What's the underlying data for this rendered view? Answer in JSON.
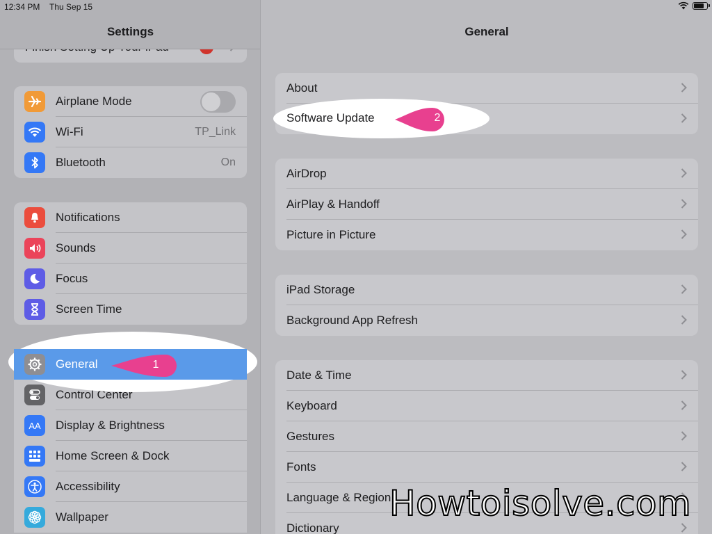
{
  "status_bar": {
    "time": "12:34 PM",
    "date": "Thu Sep 15"
  },
  "sidebar": {
    "title": "Settings",
    "partial_row": "Finish Setting Up Your iPad",
    "groups": [
      {
        "items": [
          {
            "label": "Airplane Mode",
            "icon": "airplane-icon",
            "color": "#f19a37",
            "toggle": false
          },
          {
            "label": "Wi-Fi",
            "icon": "wifi-icon",
            "color": "#3478f6",
            "value": "TP_Link"
          },
          {
            "label": "Bluetooth",
            "icon": "bluetooth-icon",
            "color": "#3478f6",
            "value": "On"
          }
        ]
      },
      {
        "items": [
          {
            "label": "Notifications",
            "icon": "bell-icon",
            "color": "#eb4d3d"
          },
          {
            "label": "Sounds",
            "icon": "speaker-icon",
            "color": "#eb445a"
          },
          {
            "label": "Focus",
            "icon": "moon-icon",
            "color": "#5e5ce6"
          },
          {
            "label": "Screen Time",
            "icon": "hourglass-icon",
            "color": "#5e5ce6"
          }
        ]
      },
      {
        "items": [
          {
            "label": "General",
            "icon": "gear-icon",
            "color": "#8e8e93",
            "selected": true
          },
          {
            "label": "Control Center",
            "icon": "toggles-icon",
            "color": "#8e8e93"
          },
          {
            "label": "Display & Brightness",
            "icon": "text-size-icon",
            "color": "#3478f6",
            "icon_text": "AA"
          },
          {
            "label": "Home Screen & Dock",
            "icon": "grid-icon",
            "color": "#3478f6"
          },
          {
            "label": "Accessibility",
            "icon": "accessibility-icon",
            "color": "#3478f6"
          },
          {
            "label": "Wallpaper",
            "icon": "flower-icon",
            "color": "#35aadc"
          }
        ]
      }
    ]
  },
  "detail": {
    "title": "General",
    "groups": [
      {
        "items": [
          "About",
          "Software Update"
        ]
      },
      {
        "items": [
          "AirDrop",
          "AirPlay & Handoff",
          "Picture in Picture"
        ]
      },
      {
        "items": [
          "iPad Storage",
          "Background App Refresh"
        ]
      },
      {
        "items": [
          "Date & Time",
          "Keyboard",
          "Gestures",
          "Fonts",
          "Language & Region",
          "Dictionary"
        ]
      }
    ]
  },
  "annotations": {
    "callout_1": "1",
    "callout_2": "2",
    "color": "#e8408f",
    "watermark": "Howtoisolve.com"
  }
}
